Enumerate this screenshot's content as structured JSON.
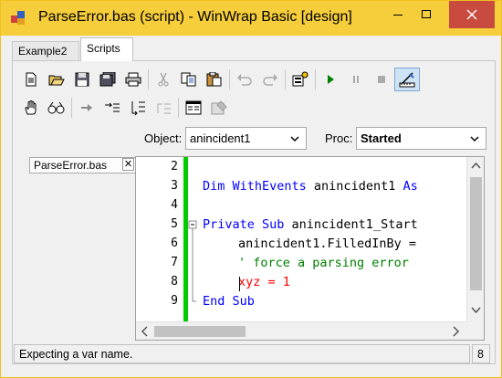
{
  "window": {
    "title": "ParseError.bas (script) - WinWrap Basic [design]"
  },
  "tabs": [
    {
      "label": "Example2",
      "active": false
    },
    {
      "label": "Scripts",
      "active": true
    }
  ],
  "toolbar": {
    "row1": [
      "new-icon",
      "open-icon",
      "save-icon",
      "save-all-icon",
      "print-icon",
      "cut-icon",
      "copy-icon",
      "paste-icon",
      "undo-icon",
      "redo-icon",
      "dialog-editor-icon",
      "run-icon",
      "pause-icon",
      "stop-icon",
      "design-mode-icon"
    ],
    "row2": [
      "hand-icon",
      "watch-icon",
      "step-icon",
      "step-into-icon",
      "step-over-icon",
      "step-out-icon",
      "module-icon",
      "properties-icon"
    ]
  },
  "selectors": {
    "object_label": "Object:",
    "object_value": "anincident1",
    "proc_label": "Proc:",
    "proc_value": "Started"
  },
  "sheet_tab": {
    "label": "ParseError.bas",
    "close": "✕"
  },
  "editor": {
    "lines": [
      {
        "num": "2",
        "text": ""
      },
      {
        "num": "3",
        "text": "Dim WithEvents anincident1 As"
      },
      {
        "num": "4",
        "text": ""
      },
      {
        "num": "5",
        "text": "Private Sub anincident1_Start"
      },
      {
        "num": "6",
        "text": "    anincident1.FilledInBy ="
      },
      {
        "num": "7",
        "text": "    ' force a parsing error"
      },
      {
        "num": "8",
        "text": "    xyz = 1"
      },
      {
        "num": "9",
        "text": "End Sub"
      }
    ],
    "code": {
      "l3_kw": "Dim WithEvents",
      "l3_rest": " anincident1 ",
      "l3_kw2": "As",
      "l5_kw": "Private Sub",
      "l5_rest": " anincident1_Start",
      "l6_text": "anincident1.FilledInBy =",
      "l7_text": "' force a parsing error",
      "l8_text": "xyz = 1",
      "l9_kw": "End Sub"
    },
    "colors": {
      "keyword": "#0000ff",
      "comment": "#008000",
      "error": "#ff0000",
      "margin": "#00cc00"
    }
  },
  "status": {
    "message": "Expecting a var name.",
    "line": "8"
  }
}
